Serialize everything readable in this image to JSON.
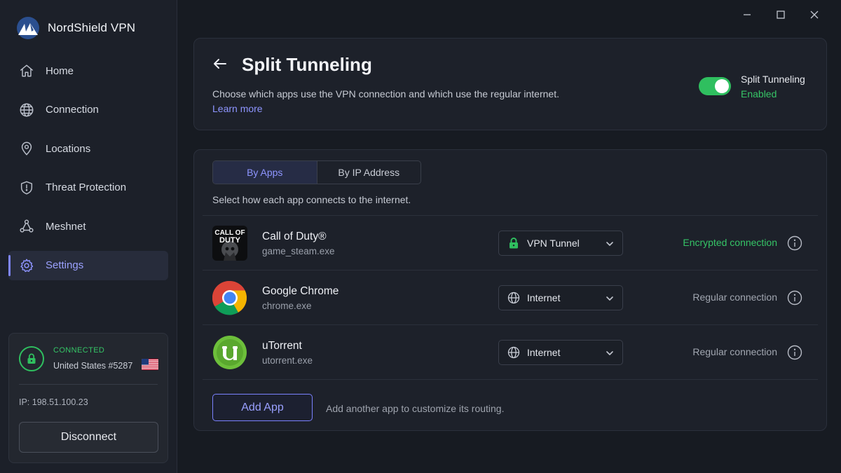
{
  "brand": {
    "name": "NordShield VPN"
  },
  "sidebar": {
    "items": [
      {
        "label": "Home",
        "icon": "home-icon"
      },
      {
        "label": "Connection",
        "icon": "globe-icon"
      },
      {
        "label": "Locations",
        "icon": "map-pin-icon"
      },
      {
        "label": "Threat Protection",
        "icon": "shield-icon"
      },
      {
        "label": "Meshnet",
        "icon": "mesh-network-icon"
      },
      {
        "label": "Settings",
        "icon": "gear-icon",
        "active": true
      }
    ]
  },
  "status": {
    "label": "CONNECTED",
    "server": "United States #5287",
    "flag": "us-flag",
    "ip": "IP: 198.51.100.23",
    "disconnect_label": "Disconnect"
  },
  "header": {
    "title": "Split Tunneling",
    "description": "Choose which apps use the VPN connection and which use the regular internet.",
    "learn_more": "Learn more",
    "toggle_title": "Split Tunneling",
    "toggle_state": "Enabled",
    "toggle_on": true
  },
  "tabs": [
    {
      "label": "By Apps",
      "active": true
    },
    {
      "label": "By IP Address",
      "active": false
    }
  ],
  "apps_description": "Select how each app connects to the internet.",
  "apps": [
    {
      "name": "Call of Duty®",
      "exe": "game_steam.exe",
      "icon": "call-of-duty-icon",
      "mode": "VPN Tunnel",
      "mode_icon": "lock-icon",
      "status": "Encrypted connection",
      "status_type": "secure"
    },
    {
      "name": "Google Chrome",
      "exe": "chrome.exe",
      "icon": "chrome-icon",
      "mode": "Internet",
      "mode_icon": "globe-icon",
      "status": "Regular connection",
      "status_type": "regular"
    },
    {
      "name": "uTorrent",
      "exe": "utorrent.exe",
      "icon": "utorrent-icon",
      "mode": "Internet",
      "mode_icon": "globe-icon",
      "status": "Regular connection",
      "status_type": "regular"
    }
  ],
  "add_app": {
    "label": "Add App",
    "hint": "Add another app to customize its routing."
  },
  "colors": {
    "accent": "#8e95ff",
    "success": "#2fbf5f",
    "background": "#171b22",
    "sidebar": "#1c2029"
  }
}
